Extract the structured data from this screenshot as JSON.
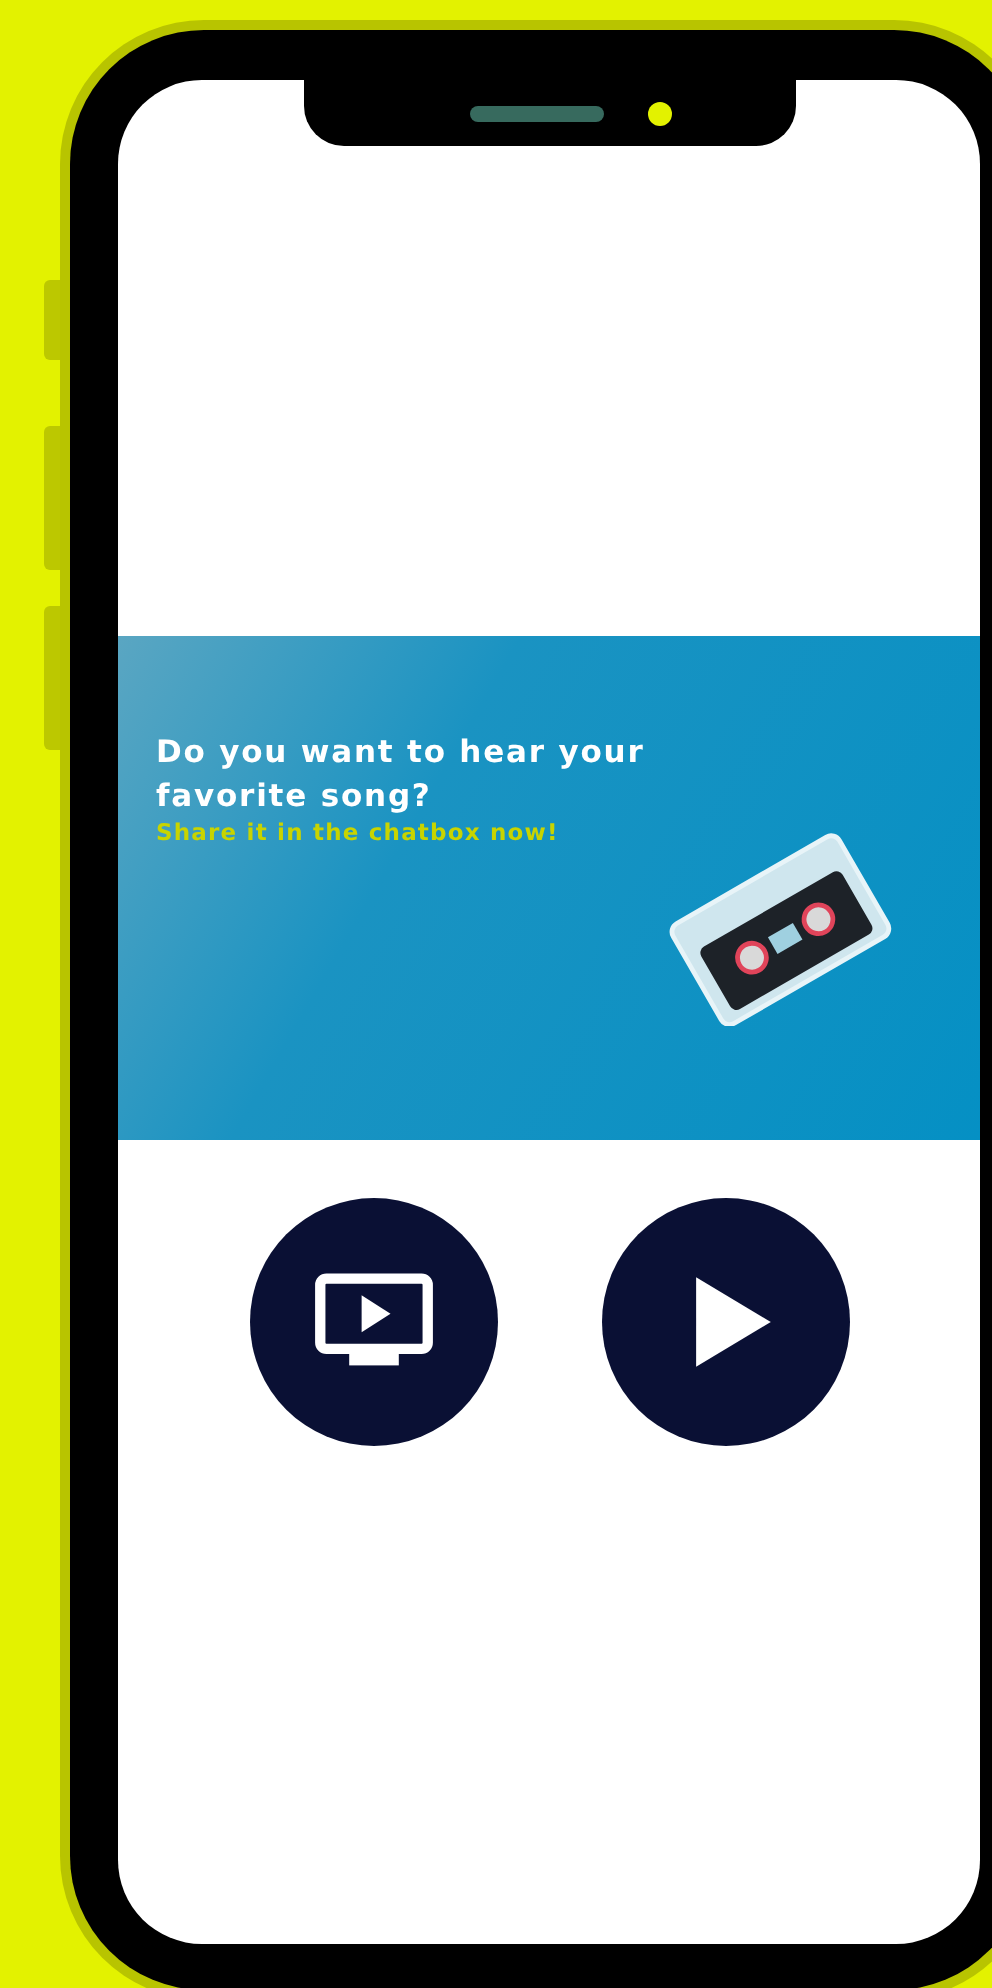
{
  "banner": {
    "title": "Do you want to hear your favorite song?",
    "subtitle": "Share it in the chatbox now!"
  },
  "buttons": [
    {
      "kind": "tv"
    },
    {
      "kind": "play"
    }
  ]
}
